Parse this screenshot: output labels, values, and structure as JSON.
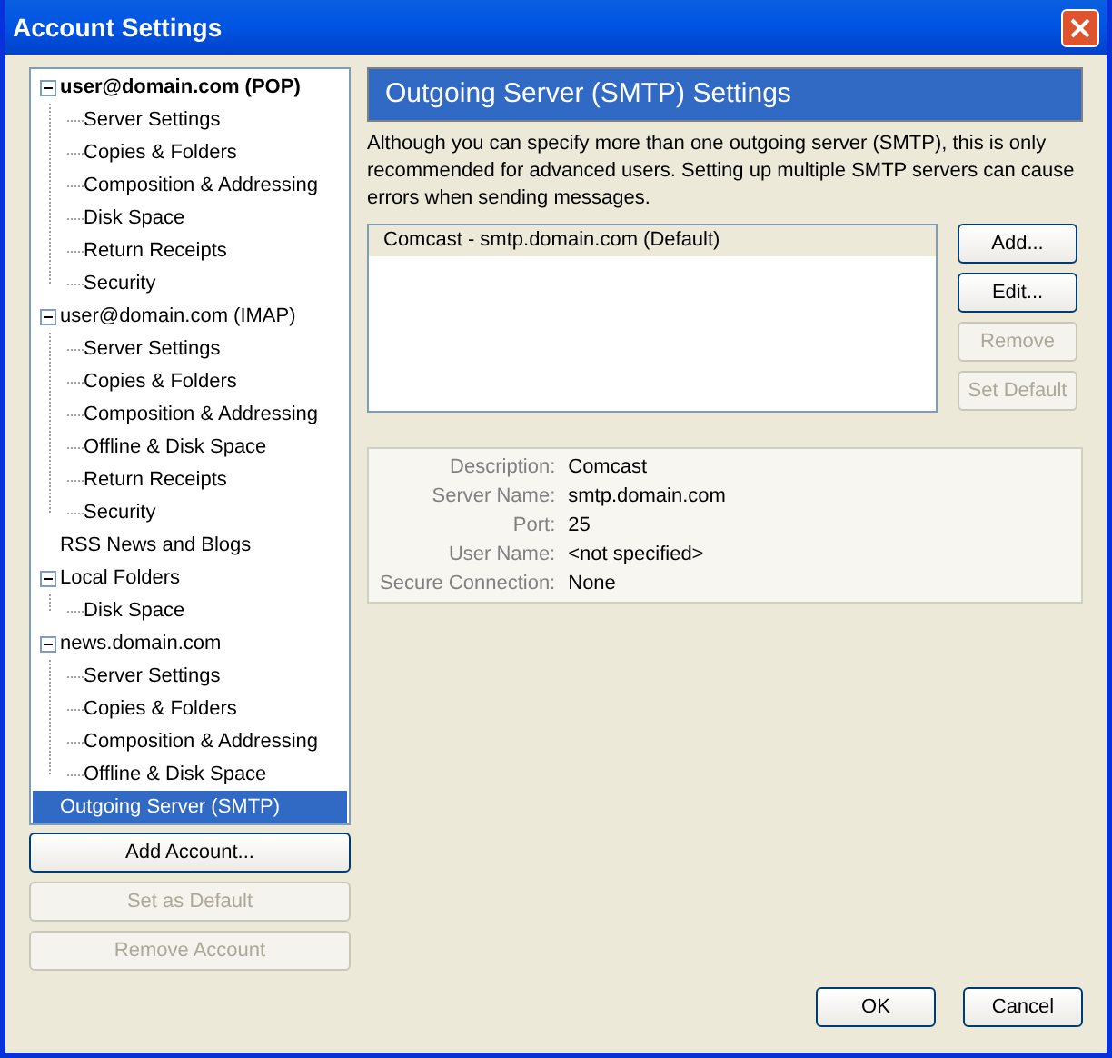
{
  "window": {
    "title": "Account Settings"
  },
  "tree": [
    {
      "label": "user@domain.com  (POP)",
      "bold": true,
      "expanded": true,
      "selected": false,
      "children": [
        {
          "label": "Server Settings",
          "selected": false
        },
        {
          "label": "Copies & Folders",
          "selected": false
        },
        {
          "label": "Composition & Addressing",
          "selected": false
        },
        {
          "label": "Disk Space",
          "selected": false
        },
        {
          "label": "Return Receipts",
          "selected": false
        },
        {
          "label": "Security",
          "selected": false
        }
      ]
    },
    {
      "label": "user@domain.com  (IMAP)",
      "bold": false,
      "expanded": true,
      "selected": false,
      "children": [
        {
          "label": "Server Settings",
          "selected": false
        },
        {
          "label": "Copies & Folders",
          "selected": false
        },
        {
          "label": "Composition & Addressing",
          "selected": false
        },
        {
          "label": "Offline & Disk Space",
          "selected": false
        },
        {
          "label": "Return Receipts",
          "selected": false
        },
        {
          "label": "Security",
          "selected": false
        }
      ]
    },
    {
      "label": "RSS News and Blogs",
      "bold": false,
      "selected": false
    },
    {
      "label": "Local Folders",
      "bold": false,
      "expanded": true,
      "selected": false,
      "children": [
        {
          "label": "Disk Space",
          "selected": false
        }
      ]
    },
    {
      "label": "news.domain.com",
      "bold": false,
      "expanded": true,
      "selected": false,
      "children": [
        {
          "label": "Server Settings",
          "selected": false
        },
        {
          "label": "Copies & Folders",
          "selected": false
        },
        {
          "label": "Composition & Addressing",
          "selected": false
        },
        {
          "label": "Offline & Disk Space",
          "selected": false
        }
      ]
    },
    {
      "label": "Outgoing Server (SMTP)",
      "bold": false,
      "selected": true
    }
  ],
  "account_buttons": [
    {
      "label": "Add Account...",
      "disabled": false
    },
    {
      "label": "Set as Default",
      "disabled": true
    },
    {
      "label": "Remove Account",
      "disabled": true
    }
  ],
  "panel": {
    "title": "Outgoing Server (SMTP) Settings",
    "description": "Although you can specify more than one outgoing server (SMTP), this is only recommended for advanced users. Setting up multiple SMTP servers can cause errors when sending messages.",
    "servers": [
      {
        "label": "Comcast - smtp.domain.com (Default)",
        "selected": true
      }
    ],
    "server_buttons": [
      {
        "label": "Add...",
        "disabled": false
      },
      {
        "label": "Edit...",
        "disabled": false
      },
      {
        "label": "Remove",
        "disabled": true
      },
      {
        "label": "Set Default",
        "disabled": true
      }
    ],
    "details": [
      {
        "label": "Description:",
        "value": "Comcast"
      },
      {
        "label": "Server Name:",
        "value": "smtp.domain.com"
      },
      {
        "label": "Port:",
        "value": "25"
      },
      {
        "label": "User Name:",
        "value": "<not specified>"
      },
      {
        "label": "Secure Connection:",
        "value": "None"
      }
    ]
  },
  "dialog_buttons": [
    {
      "label": "OK"
    },
    {
      "label": "Cancel"
    }
  ]
}
